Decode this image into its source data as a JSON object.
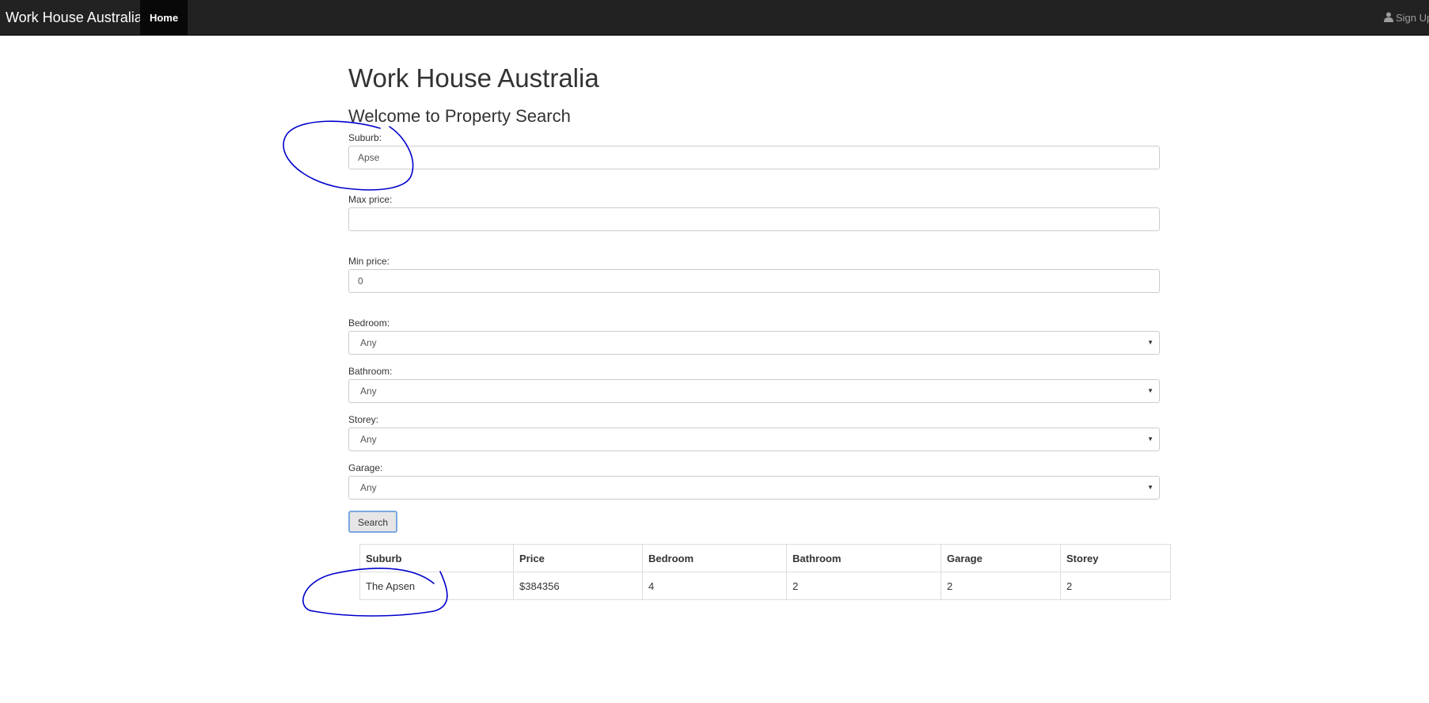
{
  "navbar": {
    "brand": "Work House Australia",
    "home_label": "Home",
    "signup_label": "Sign Up",
    "signup_icon": "user-icon"
  },
  "page": {
    "title": "Work House Australia",
    "subtitle": "Welcome to Property Search"
  },
  "form": {
    "suburb": {
      "label": "Suburb:",
      "value": "Apse"
    },
    "max_price": {
      "label": "Max price:",
      "value": ""
    },
    "min_price": {
      "label": "Min price:",
      "value": "0"
    },
    "bedroom": {
      "label": "Bedroom:",
      "selected": "Any"
    },
    "bathroom": {
      "label": "Bathroom:",
      "selected": "Any"
    },
    "storey": {
      "label": "Storey:",
      "selected": "Any"
    },
    "garage": {
      "label": "Garage:",
      "selected": "Any"
    },
    "search_label": "Search"
  },
  "results": {
    "headers": [
      "Suburb",
      "Price",
      "Bedroom",
      "Bathroom",
      "Garage",
      "Storey"
    ],
    "rows": [
      [
        "The Apsen",
        "$384356",
        "4",
        "2",
        "2",
        "2"
      ]
    ]
  },
  "colors": {
    "navbar_bg": "#222222",
    "annotation_ink": "#0000cc",
    "search_button_border": "#7aa7e0"
  }
}
